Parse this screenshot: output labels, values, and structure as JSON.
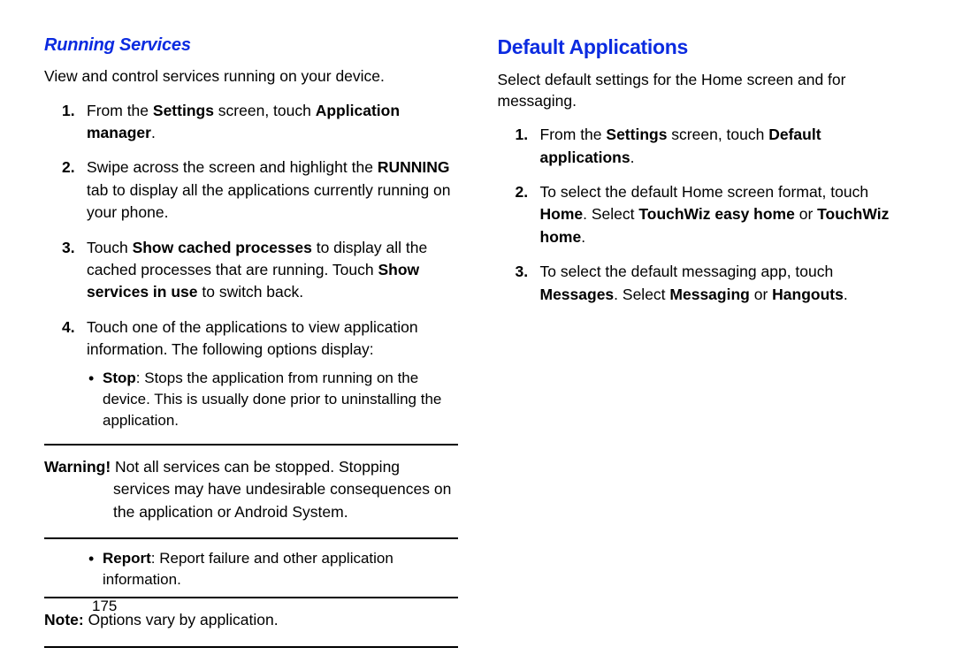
{
  "left": {
    "heading": "Running Services",
    "intro": "View and control services running on your device.",
    "steps": [
      {
        "pre": "From the ",
        "b1": "Settings",
        "mid1": " screen, touch ",
        "b2": "Application manager",
        "post": "."
      },
      {
        "pre": "Swipe across the screen and highlight the ",
        "b1": "RUNNING",
        "post": " tab to display all the applications currently running on your phone."
      },
      {
        "pre": "Touch ",
        "b1": "Show cached processes",
        "mid1": " to display all the cached processes that are running. Touch ",
        "b2": "Show services in use",
        "post": " to switch back."
      },
      {
        "text": "Touch one of the applications to view application information. The following options display:"
      }
    ],
    "bullet_stop": {
      "b": "Stop",
      "text": ": Stops the application from running on the device. This is usually done prior to uninstalling the application."
    },
    "warning": {
      "b": "Warning!",
      "text": " Not all services can be stopped. Stopping services may have undesirable consequences on the application or Android System."
    },
    "bullet_report": {
      "b": "Report",
      "text": ": Report failure and other application information."
    },
    "note": {
      "b": "Note:",
      "text": " Options vary by application."
    }
  },
  "right": {
    "heading": "Default Applications",
    "intro": "Select default settings for the Home screen and for messaging.",
    "steps": [
      {
        "pre": "From the ",
        "b1": "Settings",
        "mid1": " screen, touch ",
        "b2": "Default applications",
        "post": "."
      },
      {
        "pre": "To select the default Home screen format, touch ",
        "b1": "Home",
        "mid1": ". Select ",
        "b2": "TouchWiz easy home",
        "mid2": " or ",
        "b3": "TouchWiz home",
        "post": "."
      },
      {
        "pre": "To select the default messaging app, touch ",
        "b1": "Messages",
        "mid1": ". Select ",
        "b2": "Messaging",
        "mid2": " or ",
        "b3": "Hangouts",
        "post": "."
      }
    ]
  },
  "page_number": "175"
}
